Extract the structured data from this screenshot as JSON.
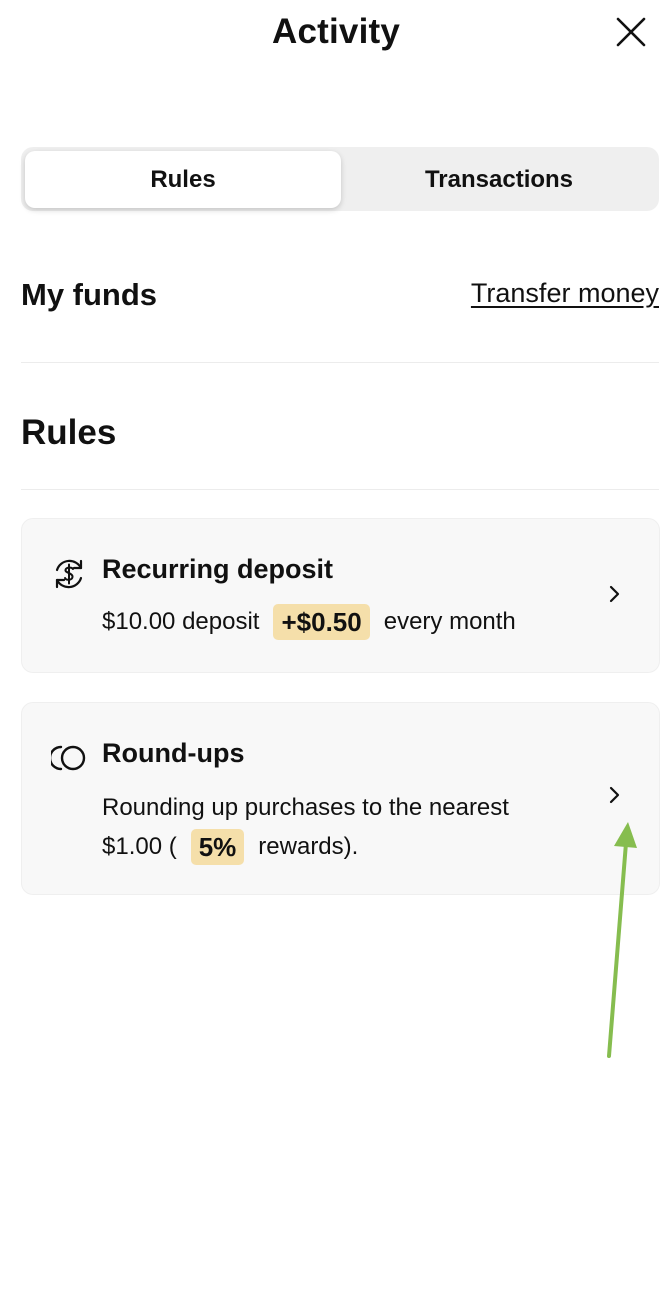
{
  "header": {
    "title": "Activity",
    "close_icon": "close-icon"
  },
  "tabs": [
    {
      "label": "Rules",
      "selected": true
    },
    {
      "label": "Transactions",
      "selected": false
    }
  ],
  "funds": {
    "title": "My funds",
    "transfer_link": "Transfer money"
  },
  "rules": {
    "title": "Rules",
    "items": [
      {
        "icon": "recurring-dollar-icon",
        "title": "Recurring deposit",
        "line1_prefix": "$10.00 deposit",
        "highlight": "+$0.50",
        "line1_suffix": "every month"
      },
      {
        "icon": "round-ups-icon",
        "title": "Round-ups",
        "line1": "Rounding up purchases to the nearest",
        "line2_prefix": "$1.00 (",
        "highlight": "5%",
        "line2_suffix": "rewards)."
      }
    ]
  },
  "colors": {
    "highlight_bg": "#f5dfaa",
    "annotation_arrow": "#86bd4f",
    "card_bg": "#f8f8f8",
    "segment_bg": "#efefef"
  }
}
